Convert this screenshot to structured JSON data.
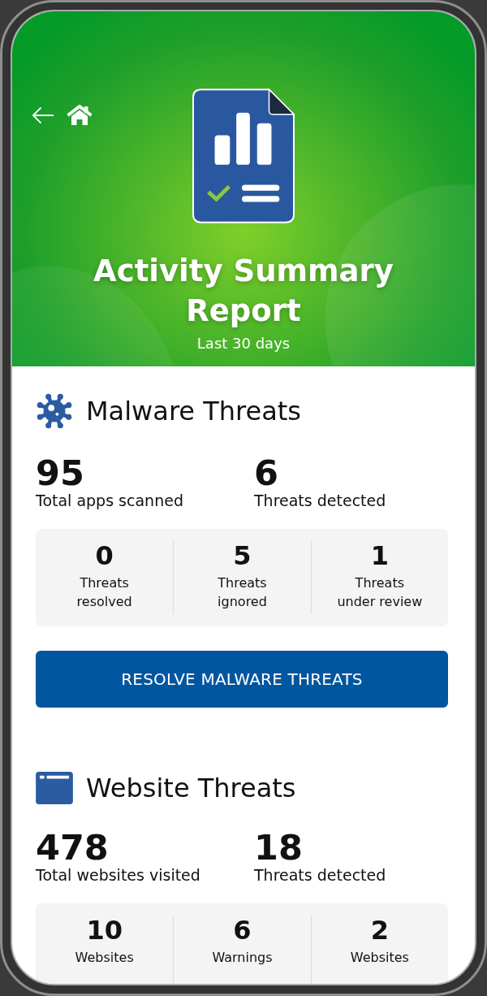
{
  "header": {
    "title": "Activity Summary Report",
    "subtitle": "Last 30 days"
  },
  "sections": [
    {
      "kind": "malware",
      "title": "Malware Threats",
      "stats": [
        {
          "value": "95",
          "label": "Total apps scanned"
        },
        {
          "value": "6",
          "label": "Threats detected"
        }
      ],
      "breakdown": [
        {
          "value": "0",
          "label": "Threats\nresolved"
        },
        {
          "value": "5",
          "label": "Threats\nignored"
        },
        {
          "value": "1",
          "label": "Threats\nunder review"
        }
      ],
      "button": "RESOLVE MALWARE THREATS"
    },
    {
      "kind": "website",
      "title": "Website Threats",
      "stats": [
        {
          "value": "478",
          "label": "Total websites visited"
        },
        {
          "value": "18",
          "label": "Threats detected"
        }
      ],
      "breakdown": [
        {
          "value": "10",
          "label": "Websites"
        },
        {
          "value": "6",
          "label": "Warnings"
        },
        {
          "value": "2",
          "label": "Websites"
        }
      ]
    }
  ]
}
